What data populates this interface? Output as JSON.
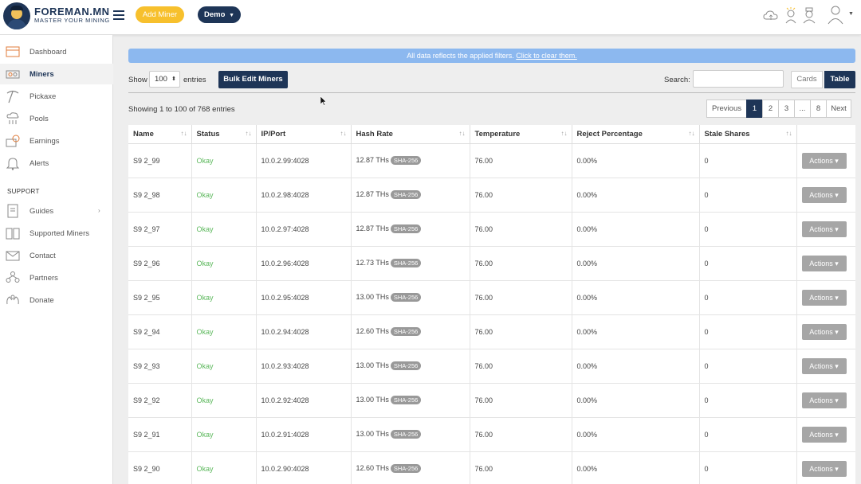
{
  "header": {
    "brand": "FOREMAN.MN",
    "tagline": "MASTER YOUR MINING",
    "add_miner_label": "Add Miner",
    "demo_label": "Demo",
    "icons": [
      "cloud-icon",
      "wizard-icon",
      "support-agent-icon",
      "user-avatar-icon"
    ]
  },
  "sidebar": {
    "items": [
      {
        "label": "Dashboard",
        "icon": "dashboard-icon"
      },
      {
        "label": "Miners",
        "icon": "miners-icon",
        "active": true
      },
      {
        "label": "Pickaxe",
        "icon": "pickaxe-icon"
      },
      {
        "label": "Pools",
        "icon": "pools-icon"
      },
      {
        "label": "Earnings",
        "icon": "earnings-icon"
      },
      {
        "label": "Alerts",
        "icon": "bell-icon"
      }
    ],
    "support_title": "SUPPORT",
    "support_items": [
      {
        "label": "Guides",
        "icon": "guides-icon",
        "chevron": "›"
      },
      {
        "label": "Supported Miners",
        "icon": "supported-miners-icon"
      },
      {
        "label": "Contact",
        "icon": "envelope-icon"
      },
      {
        "label": "Partners",
        "icon": "partners-icon"
      },
      {
        "label": "Donate",
        "icon": "hands-icon"
      }
    ]
  },
  "banner": {
    "text": "All data reflects the applied filters.",
    "link": "Click to clear them."
  },
  "controls": {
    "show_label": "Show",
    "entries_value": "100",
    "entries_label": "entries",
    "bulk_edit_label": "Bulk Edit Miners",
    "search_label": "Search:",
    "search_value": "",
    "view_cards": "Cards",
    "view_table": "Table"
  },
  "info": {
    "showing": "Showing 1 to 100 of 768 entries"
  },
  "pagination": [
    "Previous",
    "1",
    "2",
    "3",
    "...",
    "8",
    "Next"
  ],
  "table": {
    "columns": [
      "Name",
      "Status",
      "IP/Port",
      "Hash Rate",
      "Temperature",
      "Reject Percentage",
      "Stale Shares",
      ""
    ],
    "actions_label": "Actions",
    "rows": [
      {
        "name": "S9 2_99",
        "status": "Okay",
        "ip": "10.0.2.99:4028",
        "hash": "12.87 THs",
        "algo": "SHA-256",
        "temp": "76.00",
        "reject": "0.00%",
        "stale": "0"
      },
      {
        "name": "S9 2_98",
        "status": "Okay",
        "ip": "10.0.2.98:4028",
        "hash": "12.87 THs",
        "algo": "SHA-256",
        "temp": "76.00",
        "reject": "0.00%",
        "stale": "0"
      },
      {
        "name": "S9 2_97",
        "status": "Okay",
        "ip": "10.0.2.97:4028",
        "hash": "12.87 THs",
        "algo": "SHA-256",
        "temp": "76.00",
        "reject": "0.00%",
        "stale": "0"
      },
      {
        "name": "S9 2_96",
        "status": "Okay",
        "ip": "10.0.2.96:4028",
        "hash": "12.73 THs",
        "algo": "SHA-256",
        "temp": "76.00",
        "reject": "0.00%",
        "stale": "0"
      },
      {
        "name": "S9 2_95",
        "status": "Okay",
        "ip": "10.0.2.95:4028",
        "hash": "13.00 THs",
        "algo": "SHA-256",
        "temp": "76.00",
        "reject": "0.00%",
        "stale": "0"
      },
      {
        "name": "S9 2_94",
        "status": "Okay",
        "ip": "10.0.2.94:4028",
        "hash": "12.60 THs",
        "algo": "SHA-256",
        "temp": "76.00",
        "reject": "0.00%",
        "stale": "0"
      },
      {
        "name": "S9 2_93",
        "status": "Okay",
        "ip": "10.0.2.93:4028",
        "hash": "13.00 THs",
        "algo": "SHA-256",
        "temp": "76.00",
        "reject": "0.00%",
        "stale": "0"
      },
      {
        "name": "S9 2_92",
        "status": "Okay",
        "ip": "10.0.2.92:4028",
        "hash": "13.00 THs",
        "algo": "SHA-256",
        "temp": "76.00",
        "reject": "0.00%",
        "stale": "0"
      },
      {
        "name": "S9 2_91",
        "status": "Okay",
        "ip": "10.0.2.91:4028",
        "hash": "13.00 THs",
        "algo": "SHA-256",
        "temp": "76.00",
        "reject": "0.00%",
        "stale": "0"
      },
      {
        "name": "S9 2_90",
        "status": "Okay",
        "ip": "10.0.2.90:4028",
        "hash": "12.60 THs",
        "algo": "SHA-256",
        "temp": "76.00",
        "reject": "0.00%",
        "stale": "0"
      }
    ]
  },
  "colors": {
    "brand_navy": "#1e3557",
    "accent_yellow": "#f7c02d",
    "banner_blue": "#8cb8ef",
    "status_green": "#5cb85c"
  }
}
